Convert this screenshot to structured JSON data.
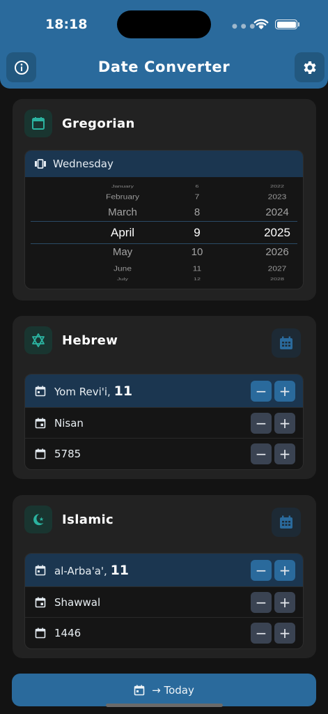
{
  "status_bar": {
    "time": "18:18"
  },
  "header": {
    "title": "Date Converter",
    "info_icon": "info-icon",
    "settings_icon": "gear-icon"
  },
  "gregorian": {
    "title": "Gregorian",
    "weekday": "Wednesday",
    "months": [
      "January",
      "February",
      "March",
      "April",
      "May",
      "June",
      "July"
    ],
    "days": [
      "6",
      "7",
      "8",
      "9",
      "10",
      "11",
      "12"
    ],
    "years": [
      "2022",
      "2023",
      "2024",
      "2025",
      "2026",
      "2027",
      "2028"
    ],
    "selected": {
      "month": "April",
      "day": "9",
      "year": "2025"
    }
  },
  "hebrew": {
    "title": "Hebrew",
    "icon": "star-of-david-icon",
    "day_name": "Yom Revi'i,",
    "day_number": "11",
    "month": "Nisan",
    "year": "5785"
  },
  "islamic": {
    "title": "Islamic",
    "icon": "crescent-star-icon",
    "day_name": "al-Arba'a',",
    "day_number": "11",
    "month": "Shawwal",
    "year": "1446"
  },
  "stepper": {
    "minus": "−",
    "plus": "+"
  },
  "footer": {
    "today_label": "→ Today"
  },
  "colors": {
    "accent": "#2a6a9c",
    "teal": "#2bb3a0",
    "card": "#222222",
    "background": "#131313"
  }
}
